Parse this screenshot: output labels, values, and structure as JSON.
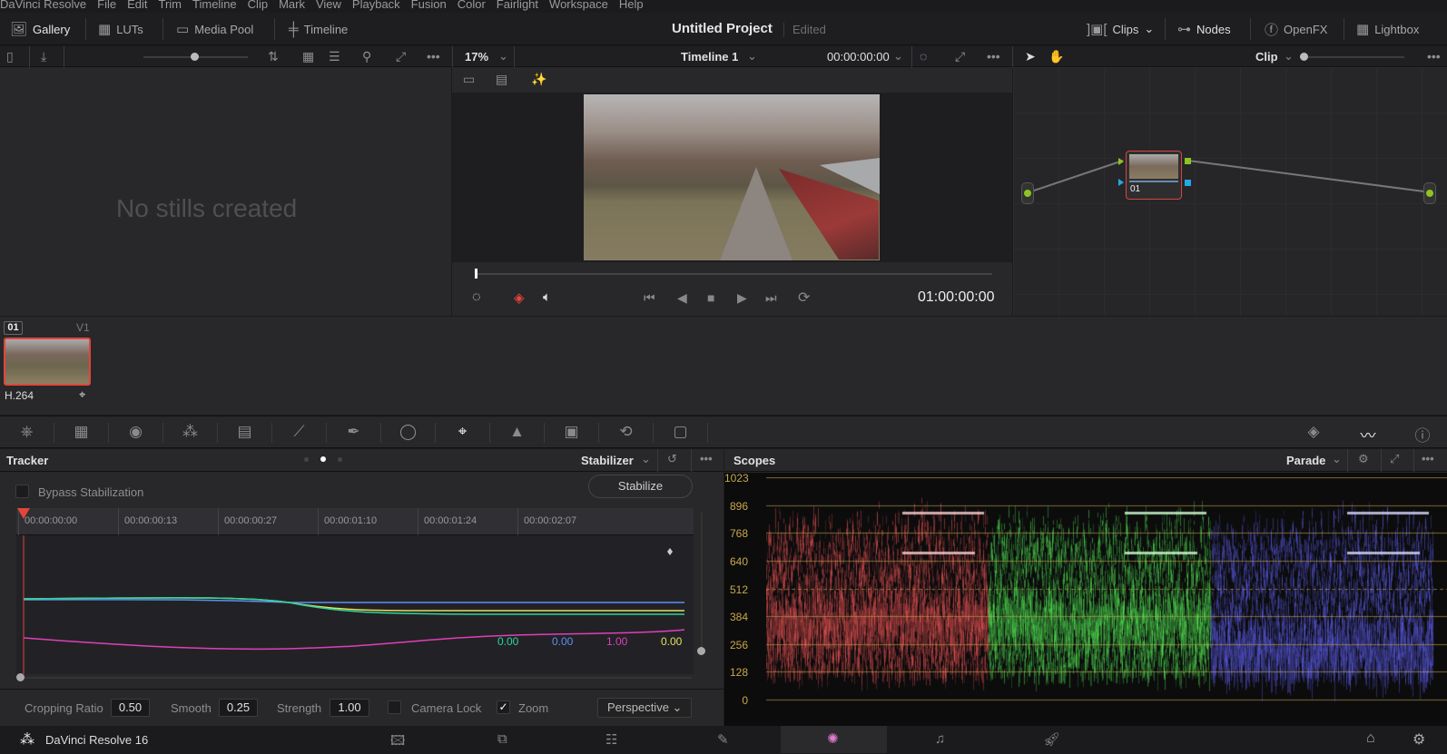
{
  "menu": [
    "DaVinci Resolve",
    "File",
    "Edit",
    "Trim",
    "Timeline",
    "Clip",
    "Mark",
    "View",
    "Playback",
    "Fusion",
    "Color",
    "Fairlight",
    "Workspace",
    "Help"
  ],
  "header": {
    "gallery": "Gallery",
    "luts": "LUTs",
    "media_pool": "Media Pool",
    "timeline": "Timeline",
    "project_title": "Untitled Project",
    "status": "Edited",
    "clips": "Clips",
    "nodes": "Nodes",
    "openfx": "OpenFX",
    "lightbox": "Lightbox"
  },
  "viewer": {
    "zoom": "17%",
    "timeline_name": "Timeline 1",
    "timecode_top": "00:00:00:00",
    "timecode": "01:00:00:00"
  },
  "node_editor": {
    "mode": "Clip",
    "node_label": "01"
  },
  "gallery": {
    "empty_text": "No stills created"
  },
  "clip": {
    "number": "01",
    "track": "V1",
    "codec": "H.264"
  },
  "tracker": {
    "title": "Tracker",
    "mode": "Stabilizer",
    "bypass_label": "Bypass Stabilization",
    "stabilize_button": "Stabilize",
    "ruler": [
      "00:00:00:00",
      "00:00:00:13",
      "00:00:00:27",
      "00:00:01:10",
      "00:00:01:24",
      "00:00:02:07"
    ],
    "values": [
      {
        "value": "0.00",
        "color": "#2fd39a"
      },
      {
        "value": "0.00",
        "color": "#5b8ff0"
      },
      {
        "value": "1.00",
        "color": "#e03fb8"
      },
      {
        "value": "0.00",
        "color": "#e3e05a"
      }
    ],
    "cropping_ratio_label": "Cropping Ratio",
    "cropping_ratio": "0.50",
    "smooth_label": "Smooth",
    "smooth": "0.25",
    "strength_label": "Strength",
    "strength": "1.00",
    "camera_lock_label": "Camera Lock",
    "camera_lock": false,
    "zoom_label": "Zoom",
    "zoom": true,
    "mode_select": "Perspective"
  },
  "scopes": {
    "title": "Scopes",
    "type": "Parade",
    "ticks": [
      "1023",
      "896",
      "768",
      "640",
      "512",
      "384",
      "256",
      "128",
      "0"
    ]
  },
  "footer": {
    "app_name": "DaVinci Resolve 16",
    "active_page": "Color"
  },
  "colors": {
    "accent_red": "#e0463a",
    "node_green": "#8fc31f",
    "node_blue": "#23a8e8",
    "scope_tick": "#c8a84a"
  }
}
